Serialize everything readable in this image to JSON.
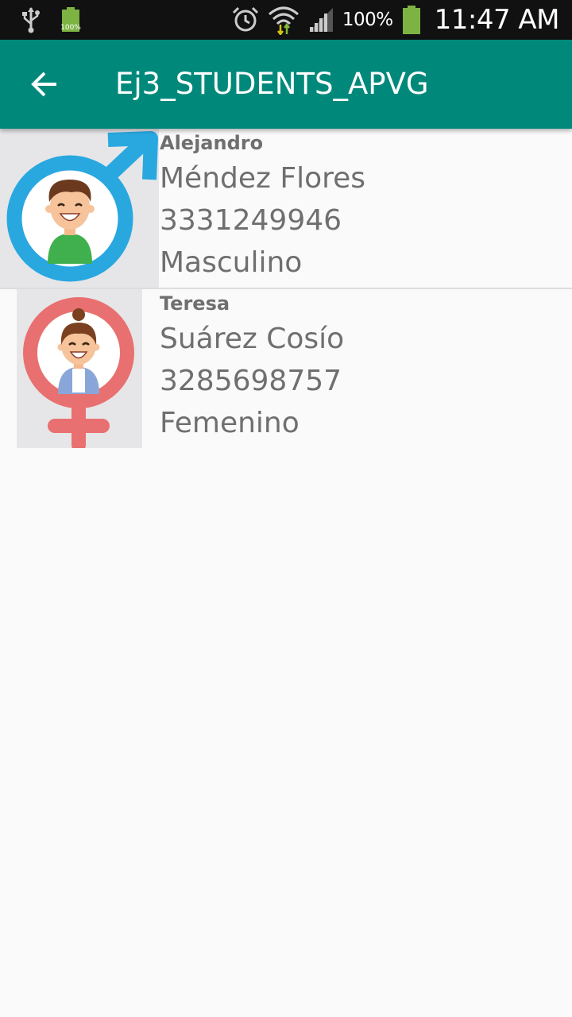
{
  "status_bar": {
    "battery_percent": "100%",
    "time": "11:47 AM",
    "icons": [
      "usb-icon",
      "battery-small-icon",
      "alarm-icon",
      "wifi-icon",
      "signal-icon",
      "battery-icon"
    ]
  },
  "app_bar": {
    "title": "Ej3_STUDENTS_APVG",
    "back_icon": "arrow-left-icon",
    "color": "#00897b"
  },
  "students": [
    {
      "first_name": "Alejandro",
      "last_name": "Méndez Flores",
      "phone": "3331249946",
      "gender": "Masculino",
      "avatar_icon": "male-symbol-avatar-icon",
      "symbol_color": "#29a8e0"
    },
    {
      "first_name": "Teresa",
      "last_name": "Suárez Cosío",
      "phone": "3285698757",
      "gender": "Femenino",
      "avatar_icon": "female-symbol-avatar-icon",
      "symbol_color": "#e97070"
    }
  ],
  "colors": {
    "background": "#fafafa",
    "text": "#6f6f6f",
    "status_bar": "#111111"
  }
}
